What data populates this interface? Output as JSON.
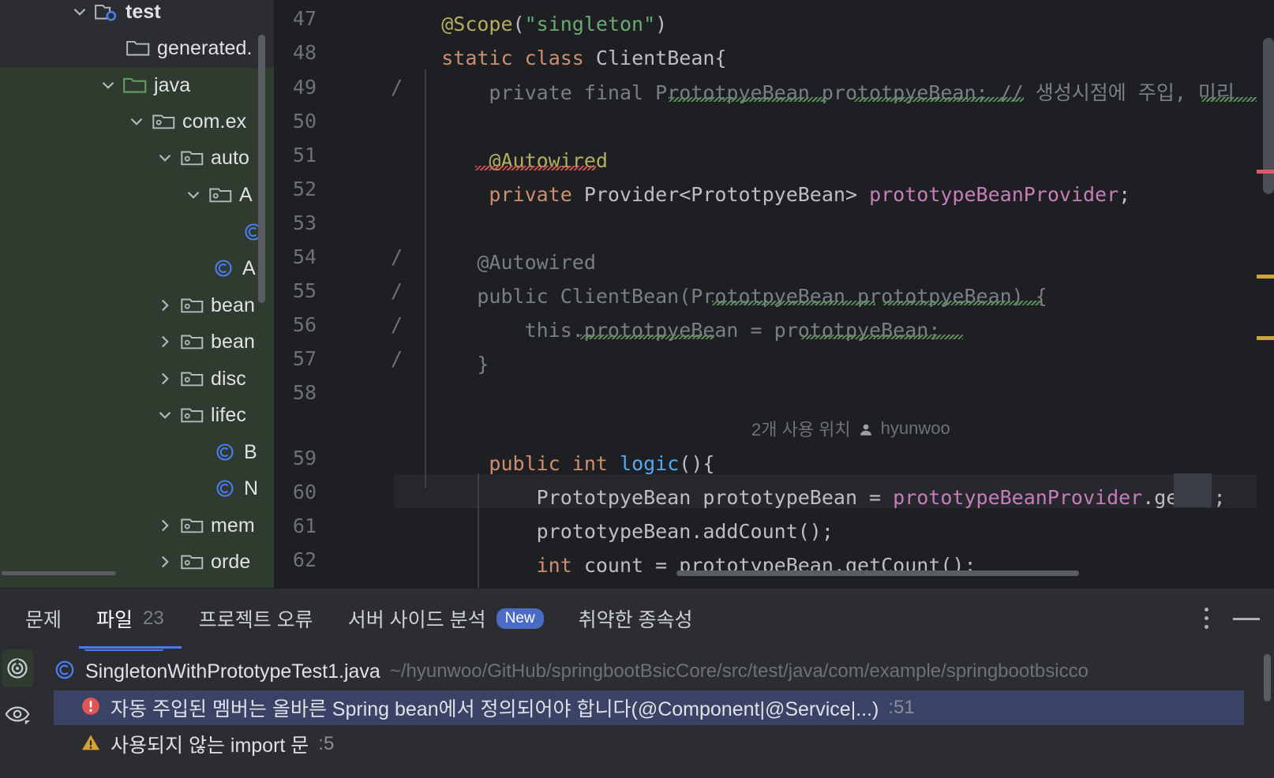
{
  "project_tree": {
    "items": [
      {
        "label": "test",
        "icon": "test-source-folder-icon",
        "expanded": true,
        "depth": 1,
        "bold": true
      },
      {
        "label": "generated.",
        "icon": "folder-icon",
        "expanded": null,
        "depth": 2,
        "bold": false
      },
      {
        "label": "java",
        "icon": "source-folder-icon",
        "expanded": true,
        "depth": 2,
        "bold": false
      },
      {
        "label": "com.ex",
        "icon": "package-icon",
        "expanded": true,
        "depth": 3,
        "bold": false
      },
      {
        "label": "auto",
        "icon": "package-icon",
        "expanded": true,
        "depth": 4,
        "bold": false
      },
      {
        "label": "A",
        "icon": "package-icon",
        "expanded": true,
        "depth": 5,
        "bold": false
      },
      {
        "label": "",
        "icon": "class-icon",
        "expanded": null,
        "depth": 7,
        "bold": false
      },
      {
        "label": "A",
        "icon": "class-icon",
        "expanded": null,
        "depth": 6,
        "bold": false
      },
      {
        "label": "bean",
        "icon": "package-icon",
        "expanded": false,
        "depth": 4,
        "bold": false
      },
      {
        "label": "bean",
        "icon": "package-icon",
        "expanded": false,
        "depth": 4,
        "bold": false
      },
      {
        "label": "disc",
        "icon": "package-icon",
        "expanded": false,
        "depth": 4,
        "bold": false
      },
      {
        "label": "lifec",
        "icon": "package-icon",
        "expanded": true,
        "depth": 4,
        "bold": false
      },
      {
        "label": "B",
        "icon": "class-icon",
        "expanded": null,
        "depth": 5,
        "bold": false
      },
      {
        "label": "N",
        "icon": "class-icon",
        "expanded": null,
        "depth": 5,
        "bold": false
      },
      {
        "label": "mem",
        "icon": "package-icon",
        "expanded": false,
        "depth": 4,
        "bold": false
      },
      {
        "label": "orde",
        "icon": "package-icon",
        "expanded": false,
        "depth": 4,
        "bold": false
      }
    ]
  },
  "editor": {
    "lines": [
      {
        "num": "47",
        "text": "    @Scope(\"singleton\")"
      },
      {
        "num": "48",
        "text": "    static class ClientBean{"
      },
      {
        "num": "49",
        "text": "        private final PrototpyeBean prototpyeBean; // 생성시점에 주입, 미리",
        "commented": true
      },
      {
        "num": "50",
        "text": ""
      },
      {
        "num": "51",
        "text": "        @Autowired"
      },
      {
        "num": "52",
        "text": "        private Provider<PrototpyeBean> prototypeBeanProvider;"
      },
      {
        "num": "53",
        "text": ""
      },
      {
        "num": "54",
        "text": "        @Autowired",
        "commented": true
      },
      {
        "num": "55",
        "text": "        public ClientBean(PrototpyeBean prototpyeBean) {",
        "commented": true
      },
      {
        "num": "56",
        "text": "            this.prototpyeBean = prototpyeBean;",
        "commented": true
      },
      {
        "num": "57",
        "text": "        }",
        "commented": true
      },
      {
        "num": "58",
        "text": ""
      },
      {
        "num": "59",
        "text": "        public int logic(){"
      },
      {
        "num": "60",
        "text": "            PrototpyeBean prototypeBean = prototypeBeanProvider.get();"
      },
      {
        "num": "61",
        "text": "            prototypeBean.addCount();"
      },
      {
        "num": "62",
        "text": "            int count = prototypeBean.getCount();"
      }
    ],
    "inlay_hint": {
      "usages": "2개 사용 위치",
      "author": "hyunwoo"
    },
    "current_line": "60",
    "comment_marker": "/"
  },
  "code_tokens": {
    "l47": [
      {
        "t": "    ",
        "c": "plain"
      },
      {
        "t": "@Scope",
        "c": "annoy"
      },
      {
        "t": "(",
        "c": "plain"
      },
      {
        "t": "\"singleton\"",
        "c": "str"
      },
      {
        "t": ")",
        "c": "plain"
      }
    ],
    "l48": [
      {
        "t": "    ",
        "c": "plain"
      },
      {
        "t": "static",
        "c": "kw"
      },
      {
        "t": " ",
        "c": "plain"
      },
      {
        "t": "class",
        "c": "kw"
      },
      {
        "t": " ",
        "c": "plain"
      },
      {
        "t": "ClientBean{",
        "c": "plain"
      }
    ],
    "l49": [
      {
        "t": "        private final PrototpyeBean prototpyeBean; // 생성시점에 주입, 미리",
        "c": "cmt"
      }
    ],
    "l51": [
      {
        "t": "        ",
        "c": "plain"
      },
      {
        "t": "@Autowired",
        "c": "annoy"
      }
    ],
    "l52": [
      {
        "t": "        ",
        "c": "plain"
      },
      {
        "t": "private",
        "c": "kw"
      },
      {
        "t": " Provider<PrototpyeBean> ",
        "c": "plain"
      },
      {
        "t": "prototypeBeanProvider",
        "c": "fld"
      },
      {
        "t": ";",
        "c": "plain"
      }
    ],
    "l54": [
      {
        "t": "       @Autowired",
        "c": "cmt"
      }
    ],
    "l55": [
      {
        "t": "       public ClientBean(PrototpyeBean prototpyeBean) {",
        "c": "cmt"
      }
    ],
    "l56": [
      {
        "t": "           this.prototpyeBean = prototpyeBean;",
        "c": "cmt"
      }
    ],
    "l57": [
      {
        "t": "       }",
        "c": "cmt"
      }
    ],
    "l59": [
      {
        "t": "        ",
        "c": "plain"
      },
      {
        "t": "public",
        "c": "kw"
      },
      {
        "t": " ",
        "c": "plain"
      },
      {
        "t": "int",
        "c": "kw"
      },
      {
        "t": " ",
        "c": "plain"
      },
      {
        "t": "logic",
        "c": "mth"
      },
      {
        "t": "(){",
        "c": "plain"
      }
    ],
    "l60": [
      {
        "t": "            PrototpyeBean prototypeBean = ",
        "c": "plain"
      },
      {
        "t": "prototypeBeanProvider",
        "c": "fld"
      },
      {
        "t": ".get();",
        "c": "plain"
      }
    ],
    "l61": [
      {
        "t": "            prototypeBean.addCount();",
        "c": "plain"
      }
    ],
    "l62": [
      {
        "t": "            ",
        "c": "plain"
      },
      {
        "t": "int",
        "c": "kw"
      },
      {
        "t": " count = prototypeBean.getCount();",
        "c": "plain"
      }
    ]
  },
  "problems_panel": {
    "tabs": [
      {
        "label": "문제",
        "count": null,
        "selected": false,
        "badge": null
      },
      {
        "label": "파일",
        "count": "23",
        "selected": true,
        "badge": null
      },
      {
        "label": "프로젝트 오류",
        "count": null,
        "selected": false,
        "badge": null
      },
      {
        "label": "서버 사이드 분석",
        "count": null,
        "selected": false,
        "badge": "New"
      },
      {
        "label": "취약한 종속성",
        "count": null,
        "selected": false,
        "badge": null
      }
    ],
    "file_row": {
      "icon": "java-class-icon",
      "name": "SingletonWithPrototypeTest1.java",
      "path": "~/hyunwoo/GitHub/springbootBsicCore/src/test/java/com/example/springbootbsicco"
    },
    "problems": [
      {
        "severity": "error",
        "icon": "error-icon",
        "text": "자동 주입된 멤버는 올바른 Spring bean에서 정의되어야 합니다(@Component|@Service|...)",
        "line": ":51",
        "selected": true
      },
      {
        "severity": "warning",
        "icon": "warning-icon",
        "text": "사용되지 않는 import 문",
        "line": ":5",
        "selected": false
      }
    ],
    "side_icons": [
      {
        "name": "inspection-scan-icon",
        "active": true
      },
      {
        "name": "eye-preview-icon",
        "active": false
      }
    ],
    "actions": [
      {
        "name": "more-options-button",
        "icon": "vertical-dots-icon"
      },
      {
        "name": "hide-panel-button",
        "icon": "minimize-icon"
      }
    ]
  },
  "colors": {
    "accent": "#4a7cf3",
    "selection": "#3a4266",
    "error": "#e05555",
    "warning": "#d8a032",
    "tree_selection": "#2f3b2e",
    "badge": "#4a6cc7"
  }
}
